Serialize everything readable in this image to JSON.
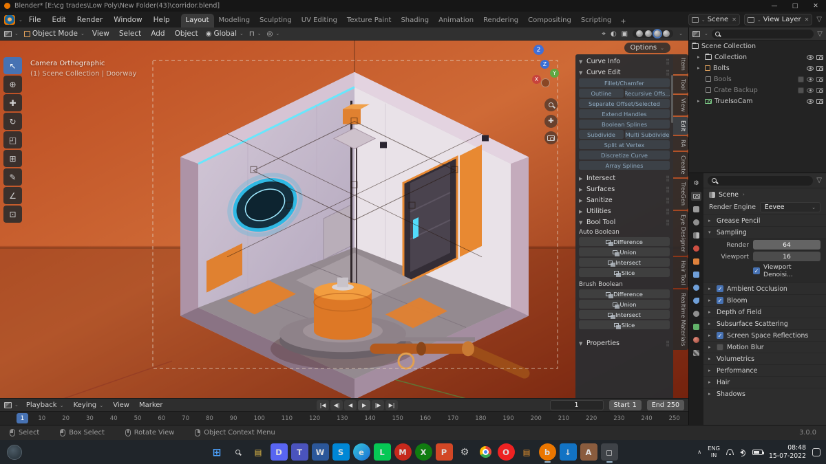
{
  "theme": {
    "accent_blue": "#4772b3",
    "viewport_orange": "#c2571f",
    "panel_bg": "#2b2d30",
    "header_bg": "#1d1d1d"
  },
  "window": {
    "title": "Blender* [E:\\cg trades\\Low Poly\\New Folder(43)\\corridor.blend]",
    "minimize": "—",
    "maximize": "□",
    "close": "✕"
  },
  "menubar": {
    "file": "File",
    "edit": "Edit",
    "render": "Render",
    "window_menu": "Window",
    "help": "Help",
    "workspaces": [
      "Layout",
      "Modeling",
      "Sculpting",
      "UV Editing",
      "Texture Paint",
      "Shading",
      "Animation",
      "Rendering",
      "Compositing",
      "Scripting"
    ],
    "add_tab": "+",
    "scene_label": "Scene",
    "view_layer_label": "View Layer"
  },
  "viewport_header": {
    "mode": "Object Mode",
    "view": "View",
    "select": "Select",
    "add": "Add",
    "object": "Object",
    "orientation": "Global",
    "options": "Options"
  },
  "toolbar": {
    "tools": [
      {
        "name": "select-box-tool",
        "glyph": "↖"
      },
      {
        "name": "cursor-tool",
        "glyph": "⊕"
      },
      {
        "name": "move-tool",
        "glyph": "✚"
      },
      {
        "name": "rotate-tool",
        "glyph": "↻"
      },
      {
        "name": "scale-tool",
        "glyph": "◰"
      },
      {
        "name": "transform-tool",
        "glyph": "⊞"
      },
      {
        "name": "annotate-tool",
        "glyph": "✎"
      },
      {
        "name": "measure-tool",
        "glyph": "∠"
      },
      {
        "name": "add-cube-tool",
        "glyph": "⊡"
      }
    ]
  },
  "viewport": {
    "camera_label": "Camera Orthographic",
    "scene_label": "(1) Scene Collection | Doorway",
    "badge": "2",
    "axis_x": "X",
    "axis_y": "Y",
    "axis_z": "Z"
  },
  "npanel": {
    "sections": {
      "curve_info": "Curve Info",
      "curve_edit": "Curve Edit",
      "intersect": "Intersect",
      "surfaces": "Surfaces",
      "sanitize": "Sanitize",
      "utilities": "Utilities",
      "bool_tool": "Bool Tool",
      "properties": "Properties"
    },
    "curve_edit_buttons": [
      "Fillet/Chamfer",
      "Outline",
      "Recursive Offs...",
      "Separate Offset/Selected",
      "Extend Handles",
      "Boolean Splines",
      "Subdivide",
      "Multi Subdivide",
      "Split at Vertex",
      "Discretize Curve",
      "Array Splines"
    ],
    "auto_boolean_label": "Auto Boolean",
    "auto_boolean_buttons": [
      "Difference",
      "Union",
      "Intersect",
      "Slice"
    ],
    "brush_boolean_label": "Brush Boolean",
    "brush_boolean_buttons": [
      "Difference",
      "Union",
      "Intersect",
      "Slice"
    ],
    "tabs": [
      "Item",
      "Tool",
      "View",
      "Edit",
      "RA",
      "Create",
      "TreeGen",
      "Eye Designer",
      "Hair Tool",
      "Realtime Materials"
    ]
  },
  "outliner": {
    "scene_collection": "Scene Collection",
    "rows": [
      {
        "label": "Collection"
      },
      {
        "label": "Bolts"
      },
      {
        "label": "Bools"
      },
      {
        "label": "Crate Backup"
      },
      {
        "label": "TrueIsoCam"
      }
    ]
  },
  "properties": {
    "breadcrumb": "Scene",
    "render_engine_label": "Render Engine",
    "render_engine_value": "Eevee",
    "sections": [
      "Grease Pencil",
      "Sampling",
      "Ambient Occlusion",
      "Bloom",
      "Depth of Field",
      "Subsurface Scattering",
      "Screen Space Reflections",
      "Motion Blur",
      "Volumetrics",
      "Performance",
      "Hair",
      "Shadows"
    ],
    "sampling": {
      "render_label": "Render",
      "render_value": "64",
      "viewport_label": "Viewport",
      "viewport_value": "16",
      "denoise_label": "Viewport Denoisi..."
    }
  },
  "timeline": {
    "playback": "Playback",
    "keying": "Keying",
    "view": "View",
    "marker": "Marker",
    "transport": [
      "|◀",
      "◀|",
      "◀",
      "▶",
      "|▶",
      "▶|"
    ],
    "current_frame": "1",
    "start_label": "Start",
    "start_value": "1",
    "end_label": "End",
    "end_value": "250",
    "ruler": [
      "1",
      "10",
      "20",
      "30",
      "40",
      "50",
      "60",
      "70",
      "80",
      "90",
      "100",
      "110",
      "120",
      "130",
      "140",
      "150",
      "160",
      "170",
      "180",
      "190",
      "200",
      "210",
      "220",
      "230",
      "240",
      "250"
    ]
  },
  "statusbar": {
    "select": "Select",
    "box_select": "Box Select",
    "rotate_view": "Rotate View",
    "context_menu": "Object Context Menu",
    "version": "3.0.0"
  },
  "taskbar": {
    "icons": [
      {
        "name": "start",
        "glyph": "⊞"
      },
      {
        "name": "search",
        "glyph": ""
      },
      {
        "name": "file-explorer",
        "glyph": "▤"
      },
      {
        "name": "discord",
        "glyph": "D"
      },
      {
        "name": "teams",
        "glyph": "T"
      },
      {
        "name": "word",
        "glyph": "W"
      },
      {
        "name": "skype",
        "glyph": "S"
      },
      {
        "name": "edge",
        "glyph": "e"
      },
      {
        "name": "line",
        "glyph": "L"
      },
      {
        "name": "mcafee",
        "glyph": "M"
      },
      {
        "name": "xbox",
        "glyph": "X"
      },
      {
        "name": "powerpoint",
        "glyph": "P"
      },
      {
        "name": "settings",
        "glyph": "⚙"
      },
      {
        "name": "chrome",
        "glyph": ""
      },
      {
        "name": "opera",
        "glyph": "O"
      },
      {
        "name": "files-orange",
        "glyph": "▤"
      },
      {
        "name": "blender",
        "glyph": "b"
      },
      {
        "name": "idm",
        "glyph": "↓"
      },
      {
        "name": "paint",
        "glyph": "A"
      },
      {
        "name": "active-window",
        "glyph": "◻"
      }
    ],
    "tray": {
      "lang_top": "ENG",
      "lang_bottom": "IN",
      "time": "08:48",
      "date": "15-07-2022"
    }
  }
}
